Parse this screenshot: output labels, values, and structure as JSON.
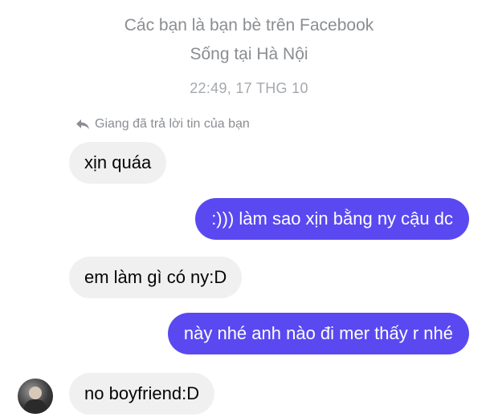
{
  "header": {
    "friends_text": "Các bạn là bạn bè trên Facebook",
    "location_text": "Sống tại Hà Nội",
    "timestamp": "22:49, 17 THG 10"
  },
  "reply_note": {
    "icon": "reply-arrow-icon",
    "text": "Giang đã trả lời tin của bạn"
  },
  "messages": [
    {
      "direction": "incoming",
      "text": "xịn quáa"
    },
    {
      "direction": "outgoing",
      "text": ":))) làm sao xịn bằng ny cậu dc"
    },
    {
      "direction": "incoming",
      "text": "em làm gì có ny:D"
    },
    {
      "direction": "outgoing",
      "text": "này nhé anh nào đi mer thấy r nhé"
    },
    {
      "direction": "incoming",
      "text": "no boyfriend:D"
    }
  ],
  "colors": {
    "outgoing_bubble": "#5a49f0",
    "incoming_bubble": "#f0f0f0",
    "meta_text": "#8a8d91"
  }
}
